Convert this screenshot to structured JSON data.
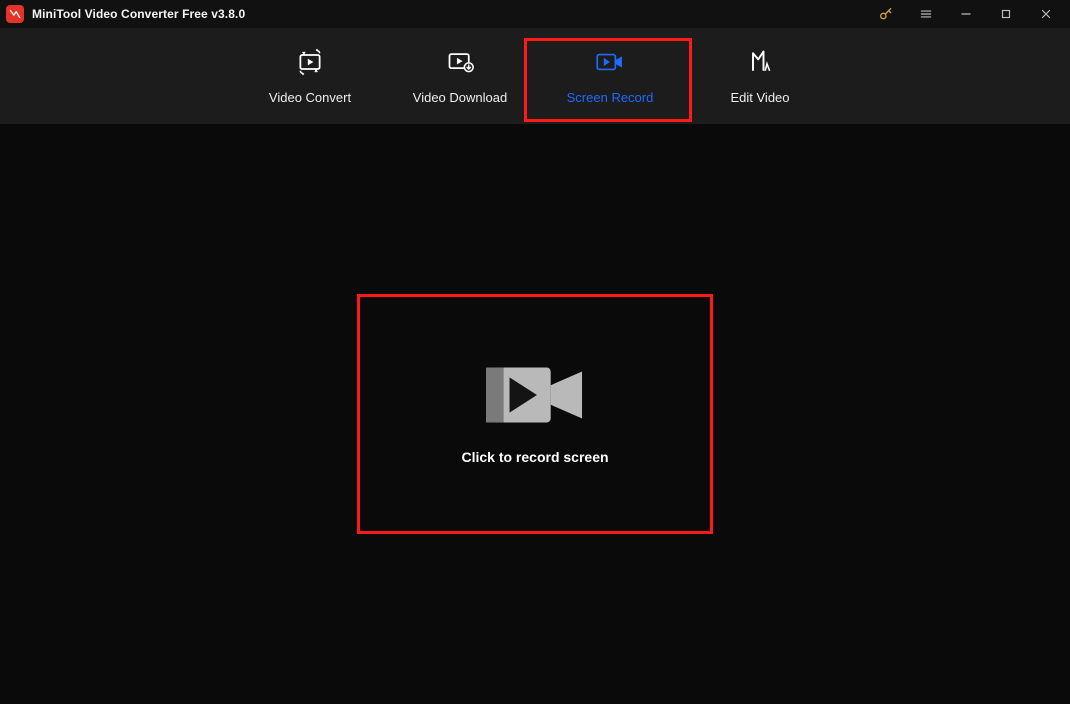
{
  "window": {
    "title": "MiniTool Video Converter Free v3.8.0"
  },
  "titlebar_icons": {
    "key": "key-icon",
    "menu": "hamburger-menu-icon",
    "minimize": "minimize-icon",
    "maximize": "maximize-icon",
    "close": "close-icon"
  },
  "nav": {
    "items": [
      {
        "id": "video-convert",
        "label": "Video Convert",
        "active": false
      },
      {
        "id": "video-download",
        "label": "Video Download",
        "active": false
      },
      {
        "id": "screen-record",
        "label": "Screen Record",
        "active": true
      },
      {
        "id": "edit-video",
        "label": "Edit Video",
        "active": false
      }
    ]
  },
  "main": {
    "record_cta": "Click to record screen"
  },
  "highlights": {
    "tab": "screen-record",
    "panel": true
  },
  "colors": {
    "accent_blue": "#1f6bff",
    "highlight_red": "#ff1a1a",
    "bg_titlebar": "#111111",
    "bg_nav": "#1c1c1c",
    "bg_main": "#0a0a0a"
  }
}
